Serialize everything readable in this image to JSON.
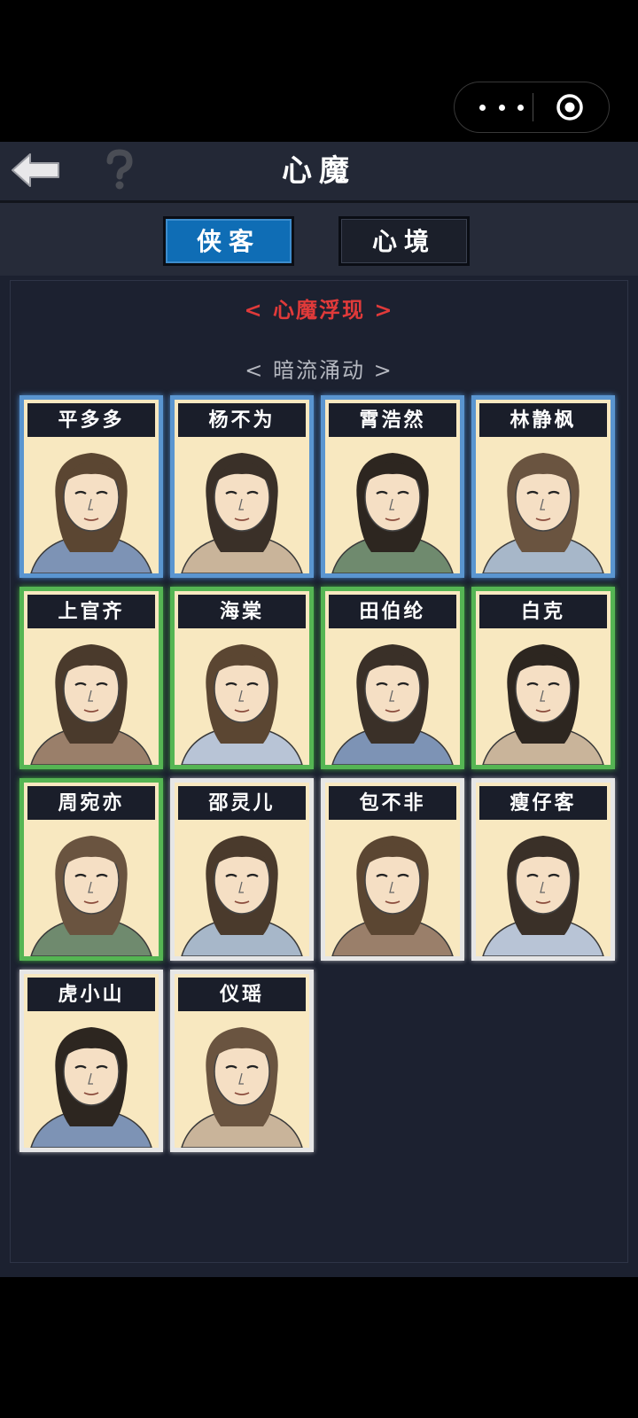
{
  "header": {
    "title": "心魔"
  },
  "tabs": [
    {
      "label": "侠客",
      "active": true
    },
    {
      "label": "心境",
      "active": false
    }
  ],
  "sections": {
    "red_heading": "< 心魔浮现 >",
    "gray_heading": "< 暗流涌动 >"
  },
  "characters": [
    {
      "name": "平多多",
      "frame": "blue"
    },
    {
      "name": "杨不为",
      "frame": "blue"
    },
    {
      "name": "霄浩然",
      "frame": "blue"
    },
    {
      "name": "林静枫",
      "frame": "blue"
    },
    {
      "name": "上官齐",
      "frame": "green"
    },
    {
      "name": "海棠",
      "frame": "green"
    },
    {
      "name": "田伯纶",
      "frame": "green"
    },
    {
      "name": "白克",
      "frame": "green"
    },
    {
      "name": "周宛亦",
      "frame": "green"
    },
    {
      "name": "邵灵儿",
      "frame": "white"
    },
    {
      "name": "包不非",
      "frame": "white"
    },
    {
      "name": "瘦仔客",
      "frame": "white"
    },
    {
      "name": "虎小山",
      "frame": "white"
    },
    {
      "name": "仪瑶",
      "frame": "white"
    }
  ],
  "icons": {
    "back": "back-arrow-icon",
    "help": "question-mark-icon",
    "menu": "more-dots-icon",
    "close": "target-circle-icon"
  },
  "colors": {
    "active_tab": "#0f6db5",
    "red_heading": "#e03a3a",
    "frame_blue": "#5a95d0",
    "frame_green": "#55b553",
    "frame_white": "#e6e6e6",
    "card_bg": "#f8e8c0"
  }
}
